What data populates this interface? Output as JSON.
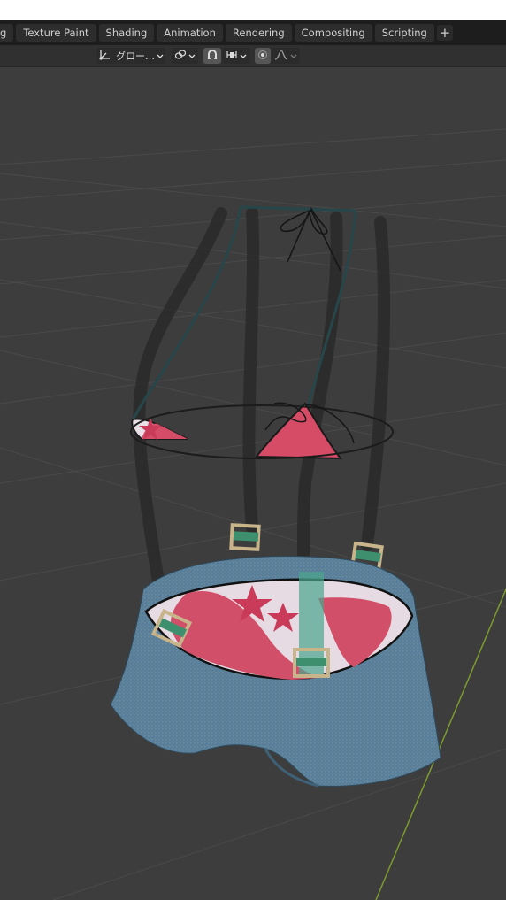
{
  "tabs": [
    "g",
    "Texture Paint",
    "Shading",
    "Animation",
    "Rendering",
    "Compositing",
    "Scripting"
  ],
  "add_tab_label": "+",
  "header": {
    "transform_orientation": "グロー…",
    "transform_orientation_icon": "orientation-gizmo-icon",
    "pivot_icon": "link-chain-icon",
    "snap_icon": "magnet-icon",
    "snap_target_icon": "snap-grid-icon",
    "proportional_edit_icon": "proportional-edit-icon",
    "falloff_icon": "falloff-curve-icon"
  },
  "viewport": {
    "background": "#3d3d3d",
    "grid_color": "#4a4a4a",
    "y_axis_color": "#7c9a2e"
  }
}
